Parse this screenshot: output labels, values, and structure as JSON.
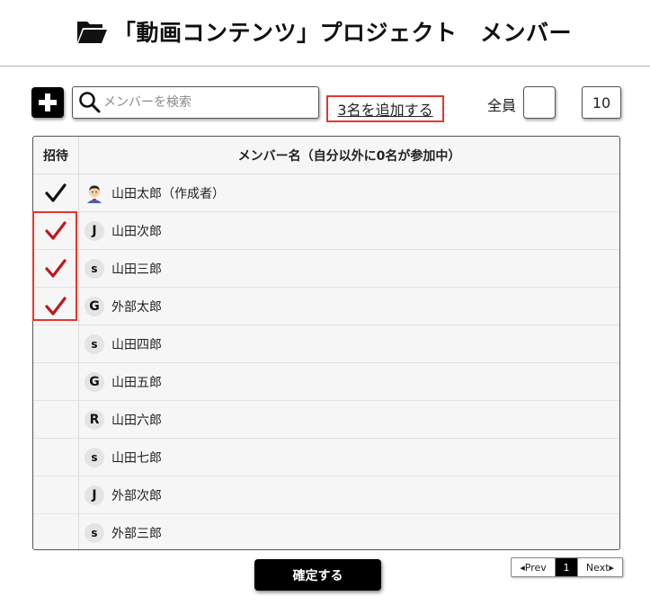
{
  "header": {
    "title": "「動画コンテンツ」プロジェクト　メンバー",
    "icon": "folder-open-icon"
  },
  "toolbar": {
    "add_icon": "plus-icon",
    "search_placeholder": "メンバーを検索",
    "search_value": "",
    "added_count_label": "3名を追加する",
    "select_all_label": "全員",
    "select_all_checked": false,
    "page_size": "10"
  },
  "table": {
    "header_invite": "招待",
    "header_name": "メンバー名（自分以外に0名が参加中）",
    "rows": [
      {
        "name": "山田太郎（作成者）",
        "avatar": "face",
        "checked": true,
        "check_color": "#111111"
      },
      {
        "name": "山田次郎",
        "avatar": "J",
        "checked": true,
        "check_color": "#c0161c"
      },
      {
        "name": "山田三郎",
        "avatar": "s",
        "checked": true,
        "check_color": "#c0161c"
      },
      {
        "name": "外部太郎",
        "avatar": "G",
        "checked": true,
        "check_color": "#c0161c"
      },
      {
        "name": "山田四郎",
        "avatar": "s",
        "checked": false
      },
      {
        "name": "山田五郎",
        "avatar": "G",
        "checked": false
      },
      {
        "name": "山田六郎",
        "avatar": "R",
        "checked": false
      },
      {
        "name": "山田七郎",
        "avatar": "s",
        "checked": false
      },
      {
        "name": "外部次郎",
        "avatar": "J",
        "checked": false
      },
      {
        "name": "外部三郎",
        "avatar": "s",
        "checked": false
      }
    ]
  },
  "footer": {
    "confirm_label": "確定する",
    "pager": {
      "prev": "◂Prev",
      "current": "1",
      "next": "Next▸"
    }
  },
  "colors": {
    "highlight": "#e8352b",
    "check_red": "#c0161c",
    "button_bg": "#000000"
  }
}
